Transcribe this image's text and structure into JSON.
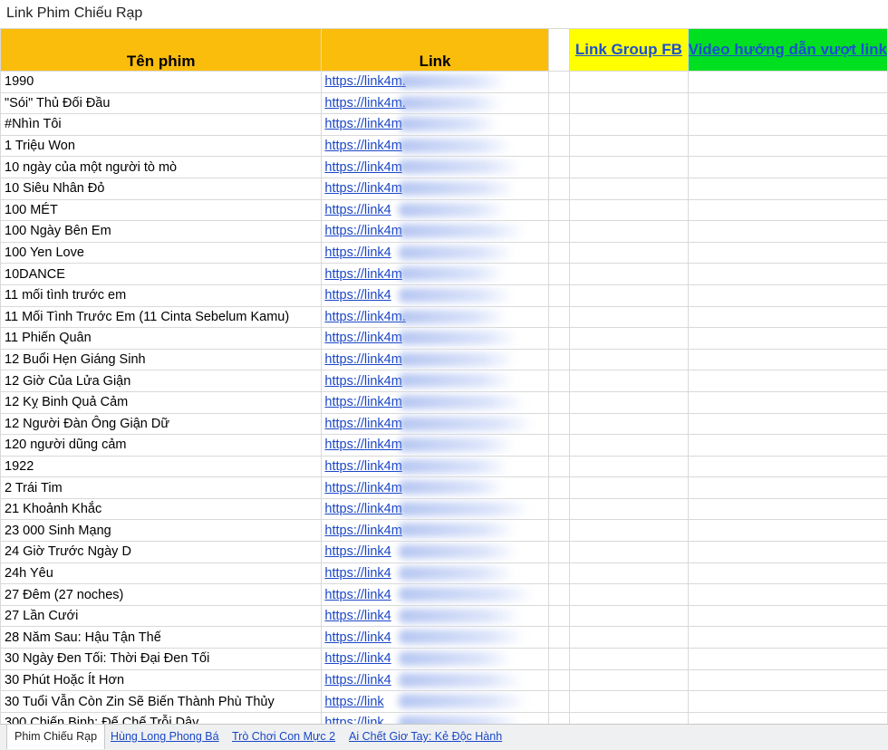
{
  "title": "Link Phim Chiếu Rạp",
  "headers": {
    "name": "Tên phim",
    "link": "Link",
    "fb": "Link Group FB",
    "video": "Video hướng dẫn vượt link"
  },
  "rows": [
    {
      "name": "1990",
      "link": "https://link4m."
    },
    {
      "name": "\"Sói\" Thủ Đối Đầu",
      "link": "https://link4m."
    },
    {
      "name": "#Nhìn Tôi",
      "link": "https://link4m"
    },
    {
      "name": "1 Triệu Won",
      "link": "https://link4m"
    },
    {
      "name": "10 ngày của một người tò mò",
      "link": "https://link4m"
    },
    {
      "name": "10 Siêu Nhân Đỏ",
      "link": "https://link4m"
    },
    {
      "name": "100 MÉT",
      "link": "https://link4"
    },
    {
      "name": "100 Ngày Bên Em",
      "link": "https://link4m"
    },
    {
      "name": "100 Yen Love",
      "link": "https://link4"
    },
    {
      "name": "10DANCE",
      "link": "https://link4m"
    },
    {
      "name": "11 mối tình trước em",
      "link": "https://link4"
    },
    {
      "name": "11 Mối Tình Trước Em (11 Cinta Sebelum Kamu)",
      "link": "https://link4m."
    },
    {
      "name": "11 Phiến Quân",
      "link": "https://link4m"
    },
    {
      "name": "12 Buổi Hẹn Giáng Sinh",
      "link": "https://link4m"
    },
    {
      "name": "12 Giờ Của Lửa Giận",
      "link": "https://link4m"
    },
    {
      "name": "12 Kỵ Binh Quả Cảm",
      "link": "https://link4m"
    },
    {
      "name": "12 Người Đàn Ông Giận Dữ",
      "link": "https://link4m"
    },
    {
      "name": "120 người dũng cảm",
      "link": "https://link4m"
    },
    {
      "name": "1922",
      "link": "https://link4m"
    },
    {
      "name": "2 Trái Tim",
      "link": "https://link4m"
    },
    {
      "name": "21 Khoảnh Khắc",
      "link": "https://link4m"
    },
    {
      "name": "23 000 Sinh Mạng",
      "link": "https://link4m"
    },
    {
      "name": "24 Giờ Trước Ngày D",
      "link": "https://link4"
    },
    {
      "name": "24h Yêu",
      "link": "https://link4"
    },
    {
      "name": "27 Đêm (27 noches)",
      "link": "https://link4"
    },
    {
      "name": "27 Lần Cưới",
      "link": "https://link4"
    },
    {
      "name": "28 Năm Sau: Hậu Tận Thế",
      "link": "https://link4"
    },
    {
      "name": "30 Ngày Đen Tối: Thời Đại Đen Tối",
      "link": "https://link4"
    },
    {
      "name": "30 Phút Hoặc Ít Hơn",
      "link": "https://link4"
    },
    {
      "name": "30 Tuổi Vẫn Còn Zin Sẽ Biến Thành Phù Thủy",
      "link": "https://link"
    },
    {
      "name": "300 Chiến Binh: Đế Chế Trỗi Dậy",
      "link": "https://link"
    }
  ],
  "tabs": [
    {
      "label": "Phim Chiếu Rạp",
      "active": true
    },
    {
      "label": "Hùng Long Phong Bá",
      "active": false
    },
    {
      "label": "Trò Chơi Con Mực 2",
      "active": false
    },
    {
      "label": "Ai Chết Giơ Tay: Kẻ Độc Hành",
      "active": false
    }
  ]
}
